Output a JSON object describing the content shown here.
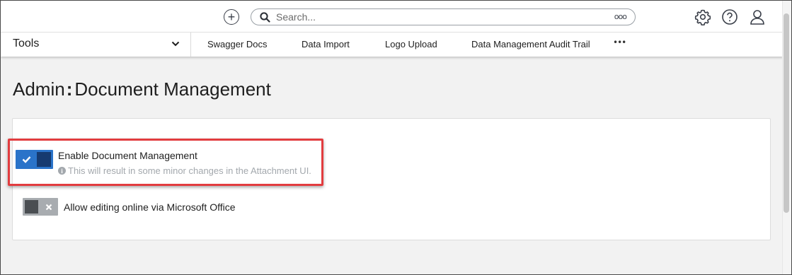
{
  "header": {
    "search_placeholder": "Search...",
    "search_options_glyph": "ooo"
  },
  "icons": {
    "add": "plus-circle-icon",
    "search": "search-icon",
    "settings": "gear-icon",
    "help": "help-circle-icon",
    "user": "user-icon",
    "chevron": "chevron-down-icon",
    "info": "info-icon"
  },
  "nav": {
    "tools_label": "Tools",
    "items": [
      "Swagger Docs",
      "Data Import",
      "Logo Upload",
      "Data Management Audit Trail"
    ],
    "more_glyph": "•••"
  },
  "page": {
    "title_prefix": "Admin",
    "title_separator": ":",
    "title_main": "Document Management"
  },
  "settings": {
    "enable_doc_mgmt": {
      "label": "Enable Document Management",
      "hint": "This will result in some minor changes in the Attachment UI.",
      "enabled": true
    },
    "allow_online_edit": {
      "label": "Allow editing online via Microsoft Office",
      "enabled": false
    }
  },
  "colors": {
    "toggle_on": "#2a73c9",
    "toggle_on_knob": "#163a70",
    "toggle_off": "#a8acb0",
    "highlight": "#e23c3f"
  }
}
